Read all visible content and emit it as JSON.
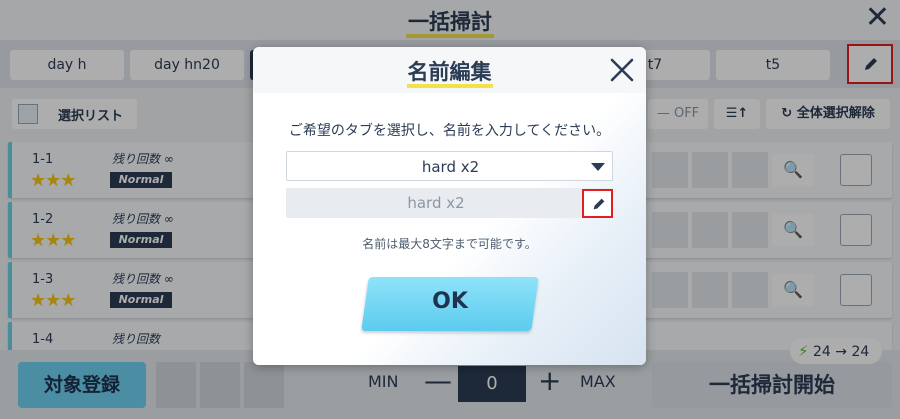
{
  "screen": {
    "title": "一括掃討",
    "tabs": [
      "day h",
      "day hn20",
      "",
      "t7",
      "t5"
    ],
    "toolbar": {
      "list_label": "選択リスト",
      "off_label": "— OFF",
      "sort_label": "☰↑",
      "deselect_all": "全体選択解除"
    },
    "stages": [
      {
        "num": "1-1",
        "remain": "残り回数 ∞",
        "stars": "★★★",
        "badge": "Normal"
      },
      {
        "num": "1-2",
        "remain": "残り回数 ∞",
        "stars": "★★★",
        "badge": "Normal"
      },
      {
        "num": "1-3",
        "remain": "残り回数 ∞",
        "stars": "★★★",
        "badge": "Normal"
      },
      {
        "num": "1-4",
        "remain": "残り回数",
        "stars": "",
        "badge": ""
      }
    ],
    "bottom": {
      "register": "対象登録",
      "min": "MIN",
      "minus": "—",
      "qty": "0",
      "plus": "+",
      "max": "MAX",
      "sweep": "一括掃討開始",
      "ap": "24 → 24"
    }
  },
  "modal": {
    "title": "名前編集",
    "description": "ご希望のタブを選択し、名前を入力してください。",
    "selected_tab": "hard x2",
    "name_placeholder": "hard x2",
    "hint": "名前は最大8文字まで可能です。",
    "ok": "OK"
  },
  "colors": {
    "accent": "#6fd0ef",
    "navy": "#2b3c55",
    "highlight": "#e02020",
    "underline": "#f2e14a"
  }
}
